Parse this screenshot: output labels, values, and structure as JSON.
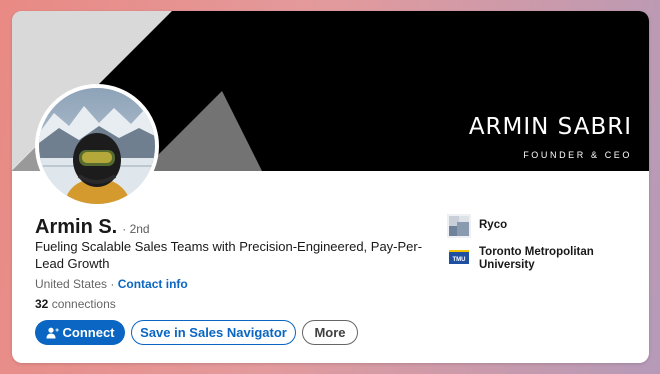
{
  "banner": {
    "name": "ARMIN SABRI",
    "role": "FOUNDER & CEO"
  },
  "profile": {
    "name": "Armin S.",
    "degree": "· 2nd",
    "headline": "Fueling Scalable Sales Teams with Precision-Engineered, Pay-Per-Lead Growth",
    "location": "United States",
    "separator": "·",
    "contact_label": "Contact info",
    "connections_count": "32",
    "connections_label": "connections"
  },
  "actions": {
    "connect_label": "Connect",
    "save_label": "Save in Sales Navigator",
    "more_label": "More"
  },
  "organizations": [
    {
      "name": "Ryco",
      "logo": "ryco-logo-icon"
    },
    {
      "name": "Toronto Metropolitan University",
      "logo": "tmu-logo-icon",
      "logo_text": "TMU"
    }
  ],
  "colors": {
    "primary": "#0a66c2",
    "banner_dark": "#000000",
    "banner_light": "#d9d9d9"
  }
}
